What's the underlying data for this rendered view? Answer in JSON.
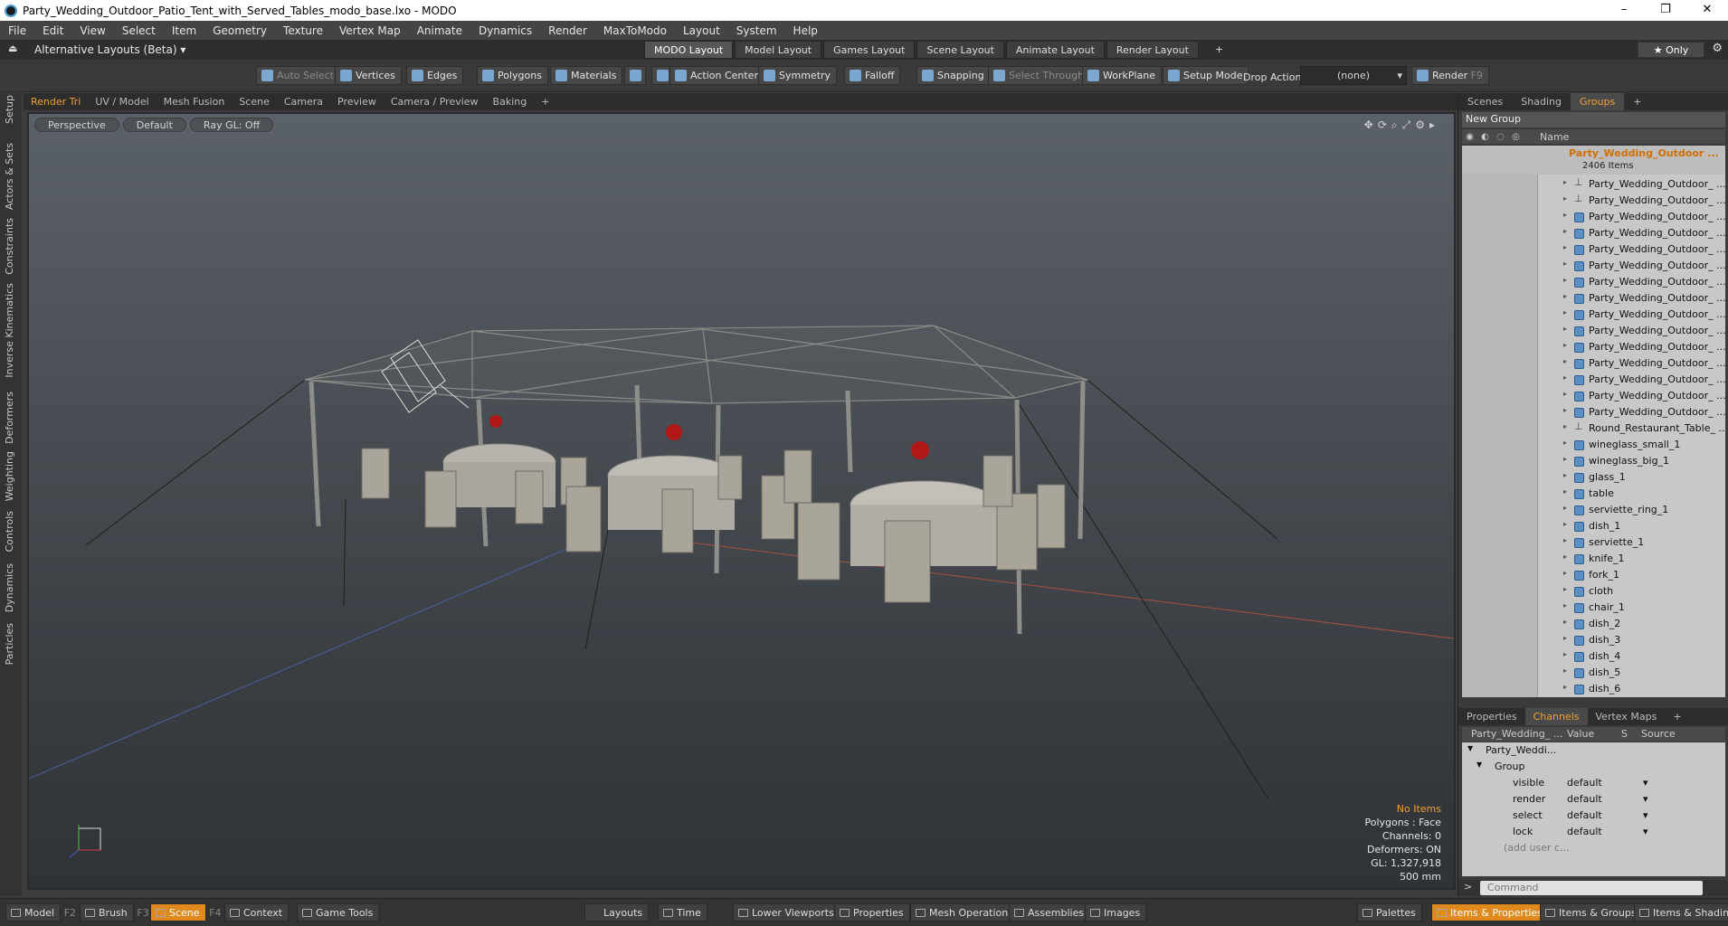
{
  "window": {
    "title": "Party_Wedding_Outdoor_Patio_Tent_with_Served_Tables_modo_base.lxo - MODO"
  },
  "menu": [
    "File",
    "Edit",
    "View",
    "Select",
    "Item",
    "Geometry",
    "Texture",
    "Vertex Map",
    "Animate",
    "Dynamics",
    "Render",
    "MaxToModo",
    "Layout",
    "System",
    "Help"
  ],
  "layout_bar": {
    "alt_layouts": "Alternative Layouts (Beta) ▾",
    "tabs": [
      "MODO Layout",
      "Model Layout",
      "Games Layout",
      "Scene Layout",
      "Animate Layout",
      "Render Layout"
    ],
    "active_tab": "MODO Layout",
    "only_label": "★ Only"
  },
  "toolbar": {
    "auto_select": "Auto Select",
    "vertices": "Vertices",
    "edges": "Edges",
    "polygons": "Polygons",
    "materials": "Materials",
    "action_center": "Action Center",
    "symmetry": "Symmetry",
    "falloff": "Falloff",
    "snapping": "Snapping",
    "select_through": "Select Through",
    "workplane": "WorkPlane",
    "setup_mode": "Setup Mode",
    "drop_action_label": "Drop Action",
    "drop_action_value": "(none)",
    "render": "Render",
    "render_key": "F9"
  },
  "left_tabs": [
    "Setup",
    "Actors & Sets",
    "Constraints",
    "Inverse Kinematics",
    "Deformers",
    "Weighting",
    "Controls",
    "Dynamics",
    "Particles"
  ],
  "viewport_tabs": [
    "Render Tri",
    "UV / Model",
    "Mesh Fusion",
    "Scene",
    "Camera",
    "Preview",
    "Camera / Preview",
    "Baking",
    "+"
  ],
  "viewport_active_tab": "Render Tri",
  "viewport": {
    "view": "Perspective",
    "shading": "Default",
    "raygl": "Ray GL: Off",
    "info": {
      "no_items": "No Items",
      "polygons": "Polygons : Face",
      "channels": "Channels: 0",
      "deformers": "Deformers: ON",
      "gl": "GL: 1,327,918",
      "scale": "500 mm"
    }
  },
  "right_panel": {
    "top_tabs": [
      "Scenes",
      "Shading",
      "Groups",
      "+"
    ],
    "top_active": "Groups",
    "new_group": "New Group",
    "col_name": "Name",
    "root": {
      "name": "Party_Wedding_Outdoor ...",
      "count": "2406 Items"
    },
    "items": [
      "Party_Wedding_Outdoor_ ...",
      "Party_Wedding_Outdoor_ ...",
      "Party_Wedding_Outdoor_ ...",
      "Party_Wedding_Outdoor_ ...",
      "Party_Wedding_Outdoor_ ...",
      "Party_Wedding_Outdoor_ ...",
      "Party_Wedding_Outdoor_ ...",
      "Party_Wedding_Outdoor_ ...",
      "Party_Wedding_Outdoor_ ...",
      "Party_Wedding_Outdoor_ ...",
      "Party_Wedding_Outdoor_ ...",
      "Party_Wedding_Outdoor_ ...",
      "Party_Wedding_Outdoor_ ...",
      "Party_Wedding_Outdoor_ ...",
      "Party_Wedding_Outdoor_ ...",
      "Round_Restaurant_Table_ ...",
      "wineglass_small_1",
      "wineglass_big_1",
      "glass_1",
      "table",
      "serviette_ring_1",
      "dish_1",
      "serviette_1",
      "knife_1",
      "fork_1",
      "cloth",
      "chair_1",
      "dish_2",
      "dish_3",
      "dish_4",
      "dish_5",
      "dish_6"
    ],
    "bottom_tabs": [
      "Properties",
      "Channels",
      "Vertex Maps",
      "+"
    ],
    "bottom_active": "Channels",
    "channels": {
      "headers": [
        "Party_Wedding_ ...",
        "Value",
        "S",
        "Source"
      ],
      "root": "Party_Weddi...",
      "group": "Group",
      "rows": [
        {
          "name": "visible",
          "value": "default"
        },
        {
          "name": "render",
          "value": "default"
        },
        {
          "name": "select",
          "value": "default"
        },
        {
          "name": "lock",
          "value": "default"
        }
      ],
      "add_user": "(add user c..."
    },
    "command_placeholder": "Command"
  },
  "bottom_bar": {
    "left": [
      {
        "label": "Model",
        "key": "F2"
      },
      {
        "label": "Brush",
        "key": "F3"
      },
      {
        "label": "Scene",
        "key": "F4",
        "active": true
      },
      {
        "label": "Context",
        "key": ""
      },
      {
        "label": "Game Tools",
        "key": ""
      }
    ],
    "center": [
      "Layouts",
      "Time",
      "Lower Viewports",
      "Properties",
      "Mesh Operations",
      "Assemblies",
      "Images"
    ],
    "right": [
      {
        "label": "Palettes"
      },
      {
        "label": "Items & Properties",
        "active": true
      },
      {
        "label": "Items & Groups"
      },
      {
        "label": "Items & Shading"
      }
    ]
  },
  "colors": {
    "accent": "#f0a030",
    "active_tab": "#e08a1e",
    "item_icon": "#5c8fc4",
    "root_text": "#d07000"
  }
}
